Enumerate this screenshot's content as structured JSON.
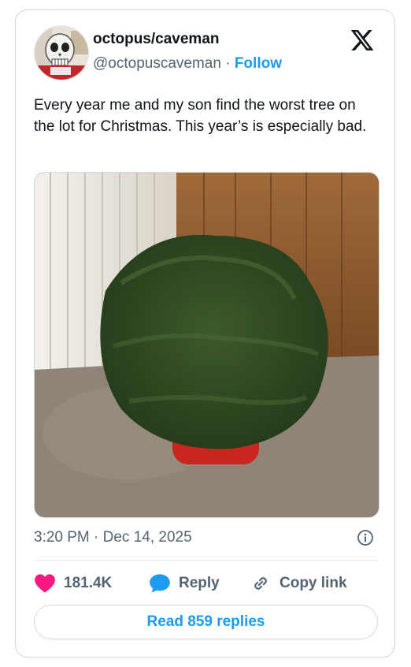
{
  "author": {
    "name": "octopus/caveman",
    "handle": "@octopuscaveman",
    "separator": "·",
    "follow_label": "Follow"
  },
  "tweet": {
    "text": "Every year me and my son find the worst tree on the lot for Christmas. This year’s is especially bad.",
    "timestamp": "3:20 PM · Dec 14, 2025"
  },
  "actions": {
    "likes": "181.4K",
    "reply_label": "Reply",
    "copy_link_label": "Copy link"
  },
  "read_replies_label": "Read 859 replies",
  "colors": {
    "accent": "#1d9bf0",
    "like": "#f91880",
    "secondary_text": "#536471",
    "border": "#cfd9de"
  },
  "icons": {
    "brand": "x-logo-icon",
    "info": "info-icon",
    "like": "heart-icon",
    "reply": "speech-bubble-icon",
    "copy": "link-icon"
  }
}
